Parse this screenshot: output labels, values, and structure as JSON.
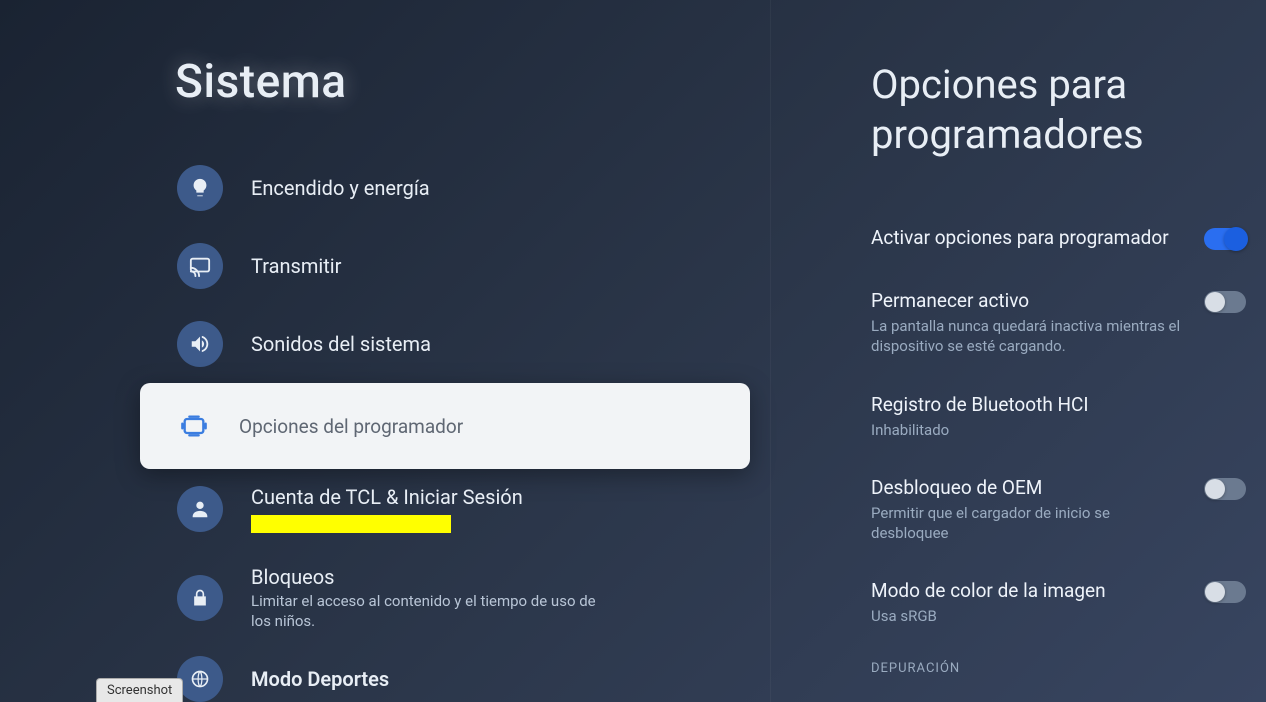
{
  "left": {
    "title": "Sistema",
    "items": [
      {
        "icon": "bulb",
        "label": "Encendido y energía",
        "sub": ""
      },
      {
        "icon": "cast",
        "label": "Transmitir",
        "sub": ""
      },
      {
        "icon": "sound",
        "label": "Sonidos del sistema",
        "sub": ""
      },
      {
        "icon": "dev",
        "label": "Opciones del programador",
        "sub": "",
        "selected": true
      },
      {
        "icon": "person",
        "label": "Cuenta de TCL & Iniciar Sesión",
        "sub": "",
        "redacted": true
      },
      {
        "icon": "lock",
        "label": "Bloqueos",
        "sub": "Limitar el acceso al contenido y el tiempo de uso de los niños."
      },
      {
        "icon": "sports",
        "label": "Modo Deportes",
        "sub": ""
      }
    ]
  },
  "right": {
    "title": "Opciones para programadores",
    "options": [
      {
        "label": "Activar opciones para programador",
        "sub": "",
        "toggle": "on"
      },
      {
        "label": "Permanecer activo",
        "sub": "La pantalla nunca quedará inactiva mientras el dispositivo se esté cargando.",
        "toggle": "off"
      },
      {
        "label": "Registro de Bluetooth HCI",
        "sub": "Inhabilitado",
        "toggle": null
      },
      {
        "label": "Desbloqueo de OEM",
        "sub": "Permitir que el cargador de inicio se desbloquee",
        "toggle": "off"
      },
      {
        "label": "Modo de color de la imagen",
        "sub": "Usa sRGB",
        "toggle": "off"
      }
    ],
    "section": "DEPURACIÓN"
  },
  "badge": "Screenshot"
}
